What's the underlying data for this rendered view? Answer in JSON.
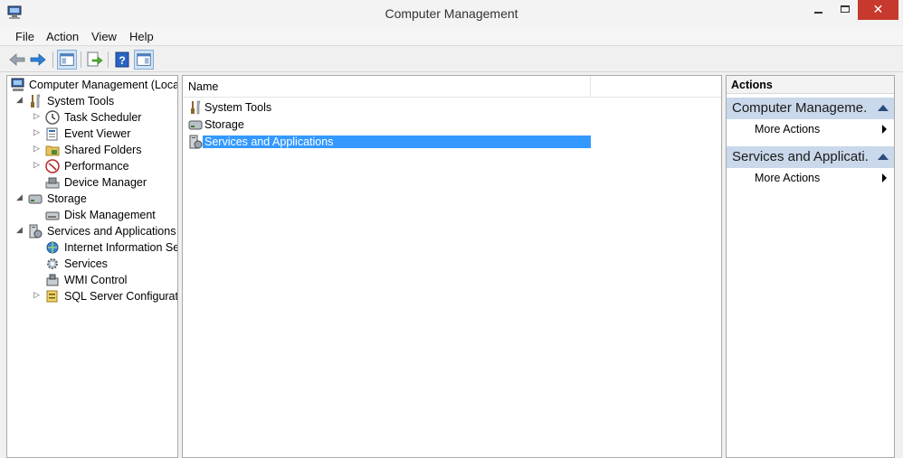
{
  "window": {
    "title": "Computer Management"
  },
  "menu": [
    "File",
    "Action",
    "View",
    "Help"
  ],
  "tree": [
    {
      "label": "Computer Management (Local",
      "icon": "computer-management-icon",
      "expander": ""
    },
    {
      "label": "System Tools",
      "icon": "system-tools-icon",
      "expander": "◢"
    },
    {
      "label": "Task Scheduler",
      "icon": "clock-icon",
      "expander": "▷"
    },
    {
      "label": "Event Viewer",
      "icon": "event-viewer-icon",
      "expander": "▷"
    },
    {
      "label": "Shared Folders",
      "icon": "shared-folders-icon",
      "expander": "▷"
    },
    {
      "label": "Performance",
      "icon": "performance-icon",
      "expander": "▷"
    },
    {
      "label": "Device Manager",
      "icon": "device-manager-icon",
      "expander": ""
    },
    {
      "label": "Storage",
      "icon": "storage-icon",
      "expander": "◢"
    },
    {
      "label": "Disk Management",
      "icon": "disk-management-icon",
      "expander": ""
    },
    {
      "label": "Services and Applications",
      "icon": "services-applications-icon",
      "expander": "◢"
    },
    {
      "label": "Internet Information Ser",
      "icon": "iis-icon",
      "expander": ""
    },
    {
      "label": "Services",
      "icon": "services-gear-icon",
      "expander": ""
    },
    {
      "label": "WMI Control",
      "icon": "wmi-control-icon",
      "expander": ""
    },
    {
      "label": "SQL Server Configuratic",
      "icon": "sql-server-icon",
      "expander": "▷"
    }
  ],
  "list": {
    "column_name": "Name",
    "rows": [
      {
        "label": "System Tools",
        "icon": "system-tools-icon",
        "selected": false
      },
      {
        "label": "Storage",
        "icon": "storage-icon",
        "selected": false
      },
      {
        "label": "Services and Applications",
        "icon": "services-applications-icon",
        "selected": true
      }
    ]
  },
  "actions": {
    "title": "Actions",
    "groups": [
      {
        "label": "Computer Manageme...",
        "item": "More Actions"
      },
      {
        "label": "Services and Applicati...",
        "item": "More Actions"
      }
    ]
  },
  "colors": {
    "selection": "#3399ff",
    "action_group": "#c9d8ea",
    "close_button": "#c7392d"
  }
}
